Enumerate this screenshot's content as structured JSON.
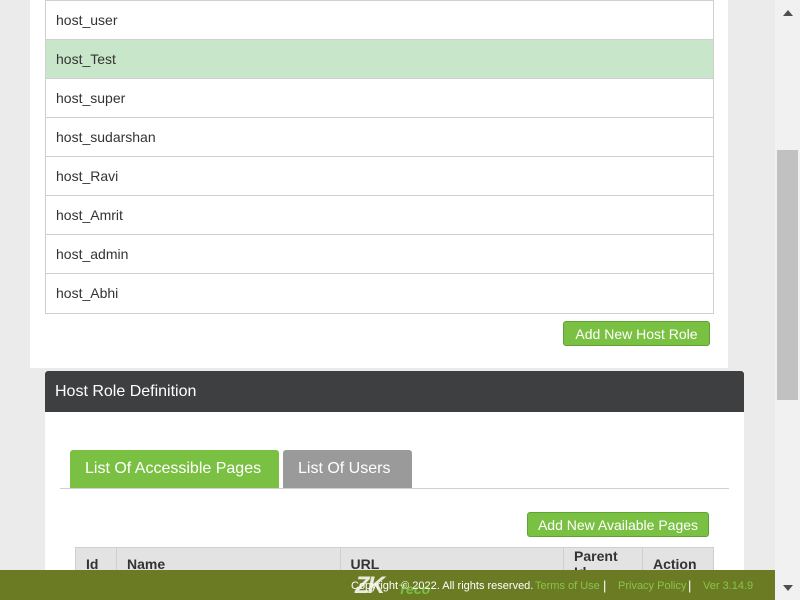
{
  "roles": {
    "items": [
      "host_user",
      "host_Test",
      "host_super",
      "host_sudarshan",
      "host_Ravi",
      "host_Amrit",
      "host_admin",
      "host_Abhi"
    ],
    "selected": "host_Test",
    "add_button": "Add New Host Role"
  },
  "definition": {
    "title": "Host Role Definition",
    "tabs": [
      "List Of Accessible Pages",
      "List Of Users"
    ],
    "add_pages_button": "Add New Available Pages",
    "columns": [
      "Id",
      "Name",
      "URL",
      "Parent Id",
      "Action"
    ]
  },
  "footer": {
    "logo": "ZK",
    "logo_sub": "Teco",
    "copyright": "Copyright © 2022. All rights reserved.",
    "terms": "Terms of Use",
    "privacy": "Privacy Policy",
    "version": "Ver 3.14.9"
  },
  "colors": {
    "accent": "#7ac143",
    "header": "#3d3f41",
    "selected_row": "#c8e6c9",
    "footer": "#6b7b24"
  }
}
